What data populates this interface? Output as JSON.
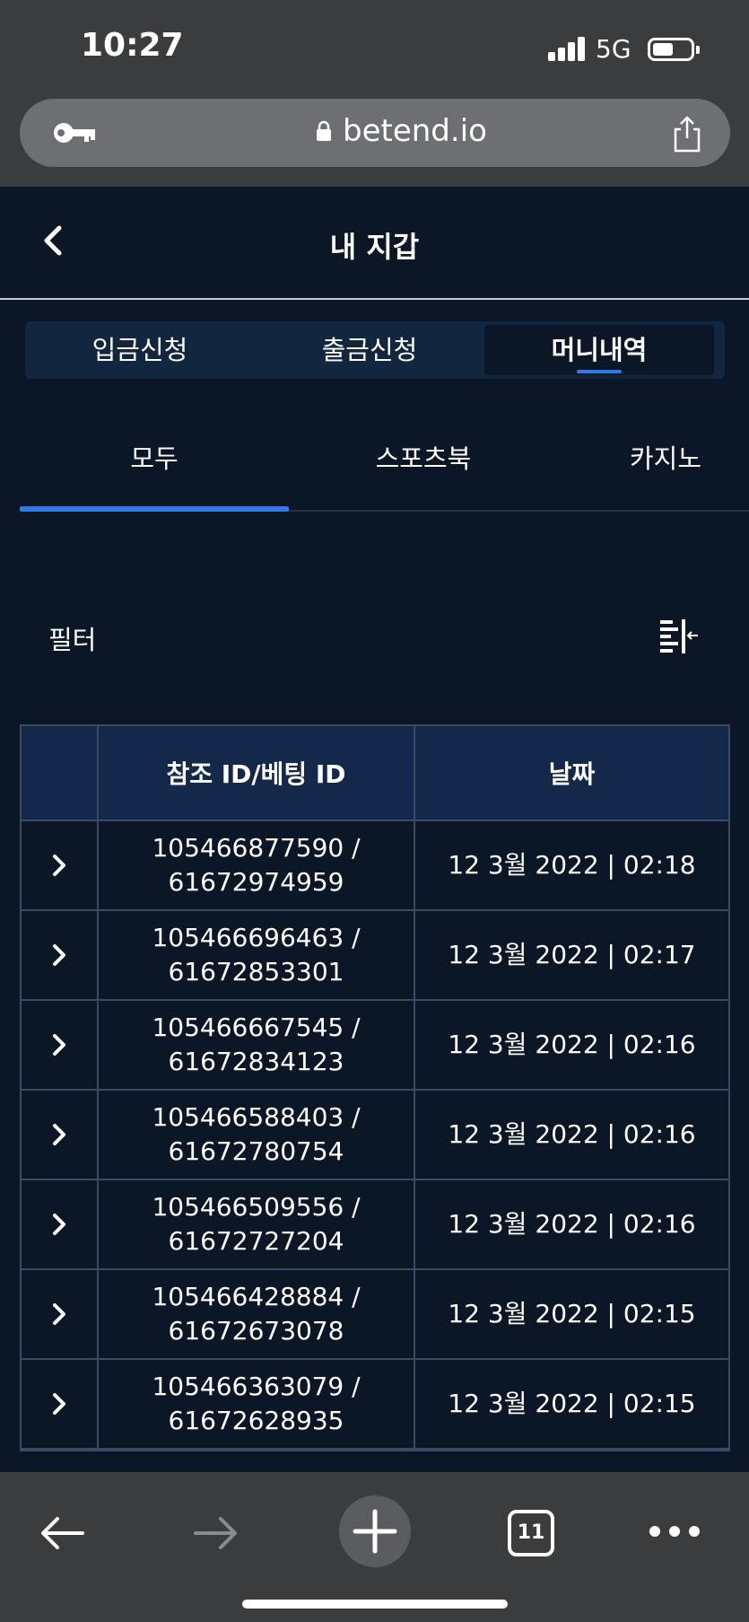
{
  "status_bar": {
    "time": "10:27",
    "network": "5G"
  },
  "browser": {
    "url": "betend.io",
    "open_tabs_count": "11"
  },
  "header": {
    "title": "내 지갑"
  },
  "wallet_tabs": [
    {
      "label": "입금신청",
      "active": false
    },
    {
      "label": "출금신청",
      "active": false
    },
    {
      "label": "머니내역",
      "active": true
    }
  ],
  "sub_tabs": [
    {
      "label": "모두",
      "active": true
    },
    {
      "label": "스포츠북",
      "active": false
    },
    {
      "label": "카지노",
      "active": false
    }
  ],
  "filter": {
    "label": "필터"
  },
  "table": {
    "headers": [
      "",
      "참조 ID/베팅 ID",
      "날짜"
    ],
    "rows": [
      {
        "ref_id": "105466877590 /",
        "bet_id": "61672974959",
        "date": "12 3월 2022 | 02:18"
      },
      {
        "ref_id": "105466696463 /",
        "bet_id": "61672853301",
        "date": "12 3월 2022 | 02:17"
      },
      {
        "ref_id": "105466667545 /",
        "bet_id": "61672834123",
        "date": "12 3월 2022 | 02:16"
      },
      {
        "ref_id": "105466588403 /",
        "bet_id": "61672780754",
        "date": "12 3월 2022 | 02:16"
      },
      {
        "ref_id": "105466509556 /",
        "bet_id": "61672727204",
        "date": "12 3월 2022 | 02:16"
      },
      {
        "ref_id": "105466428884 /",
        "bet_id": "61672673078",
        "date": "12 3월 2022 | 02:15"
      },
      {
        "ref_id": "105466363079 /",
        "bet_id": "61672628935",
        "date": "12 3월 2022 | 02:15"
      }
    ]
  },
  "colors": {
    "background": "#0b1627",
    "accent": "#2f7ae5",
    "header_row": "#13284a",
    "browser_chrome": "#3b3c3e"
  }
}
